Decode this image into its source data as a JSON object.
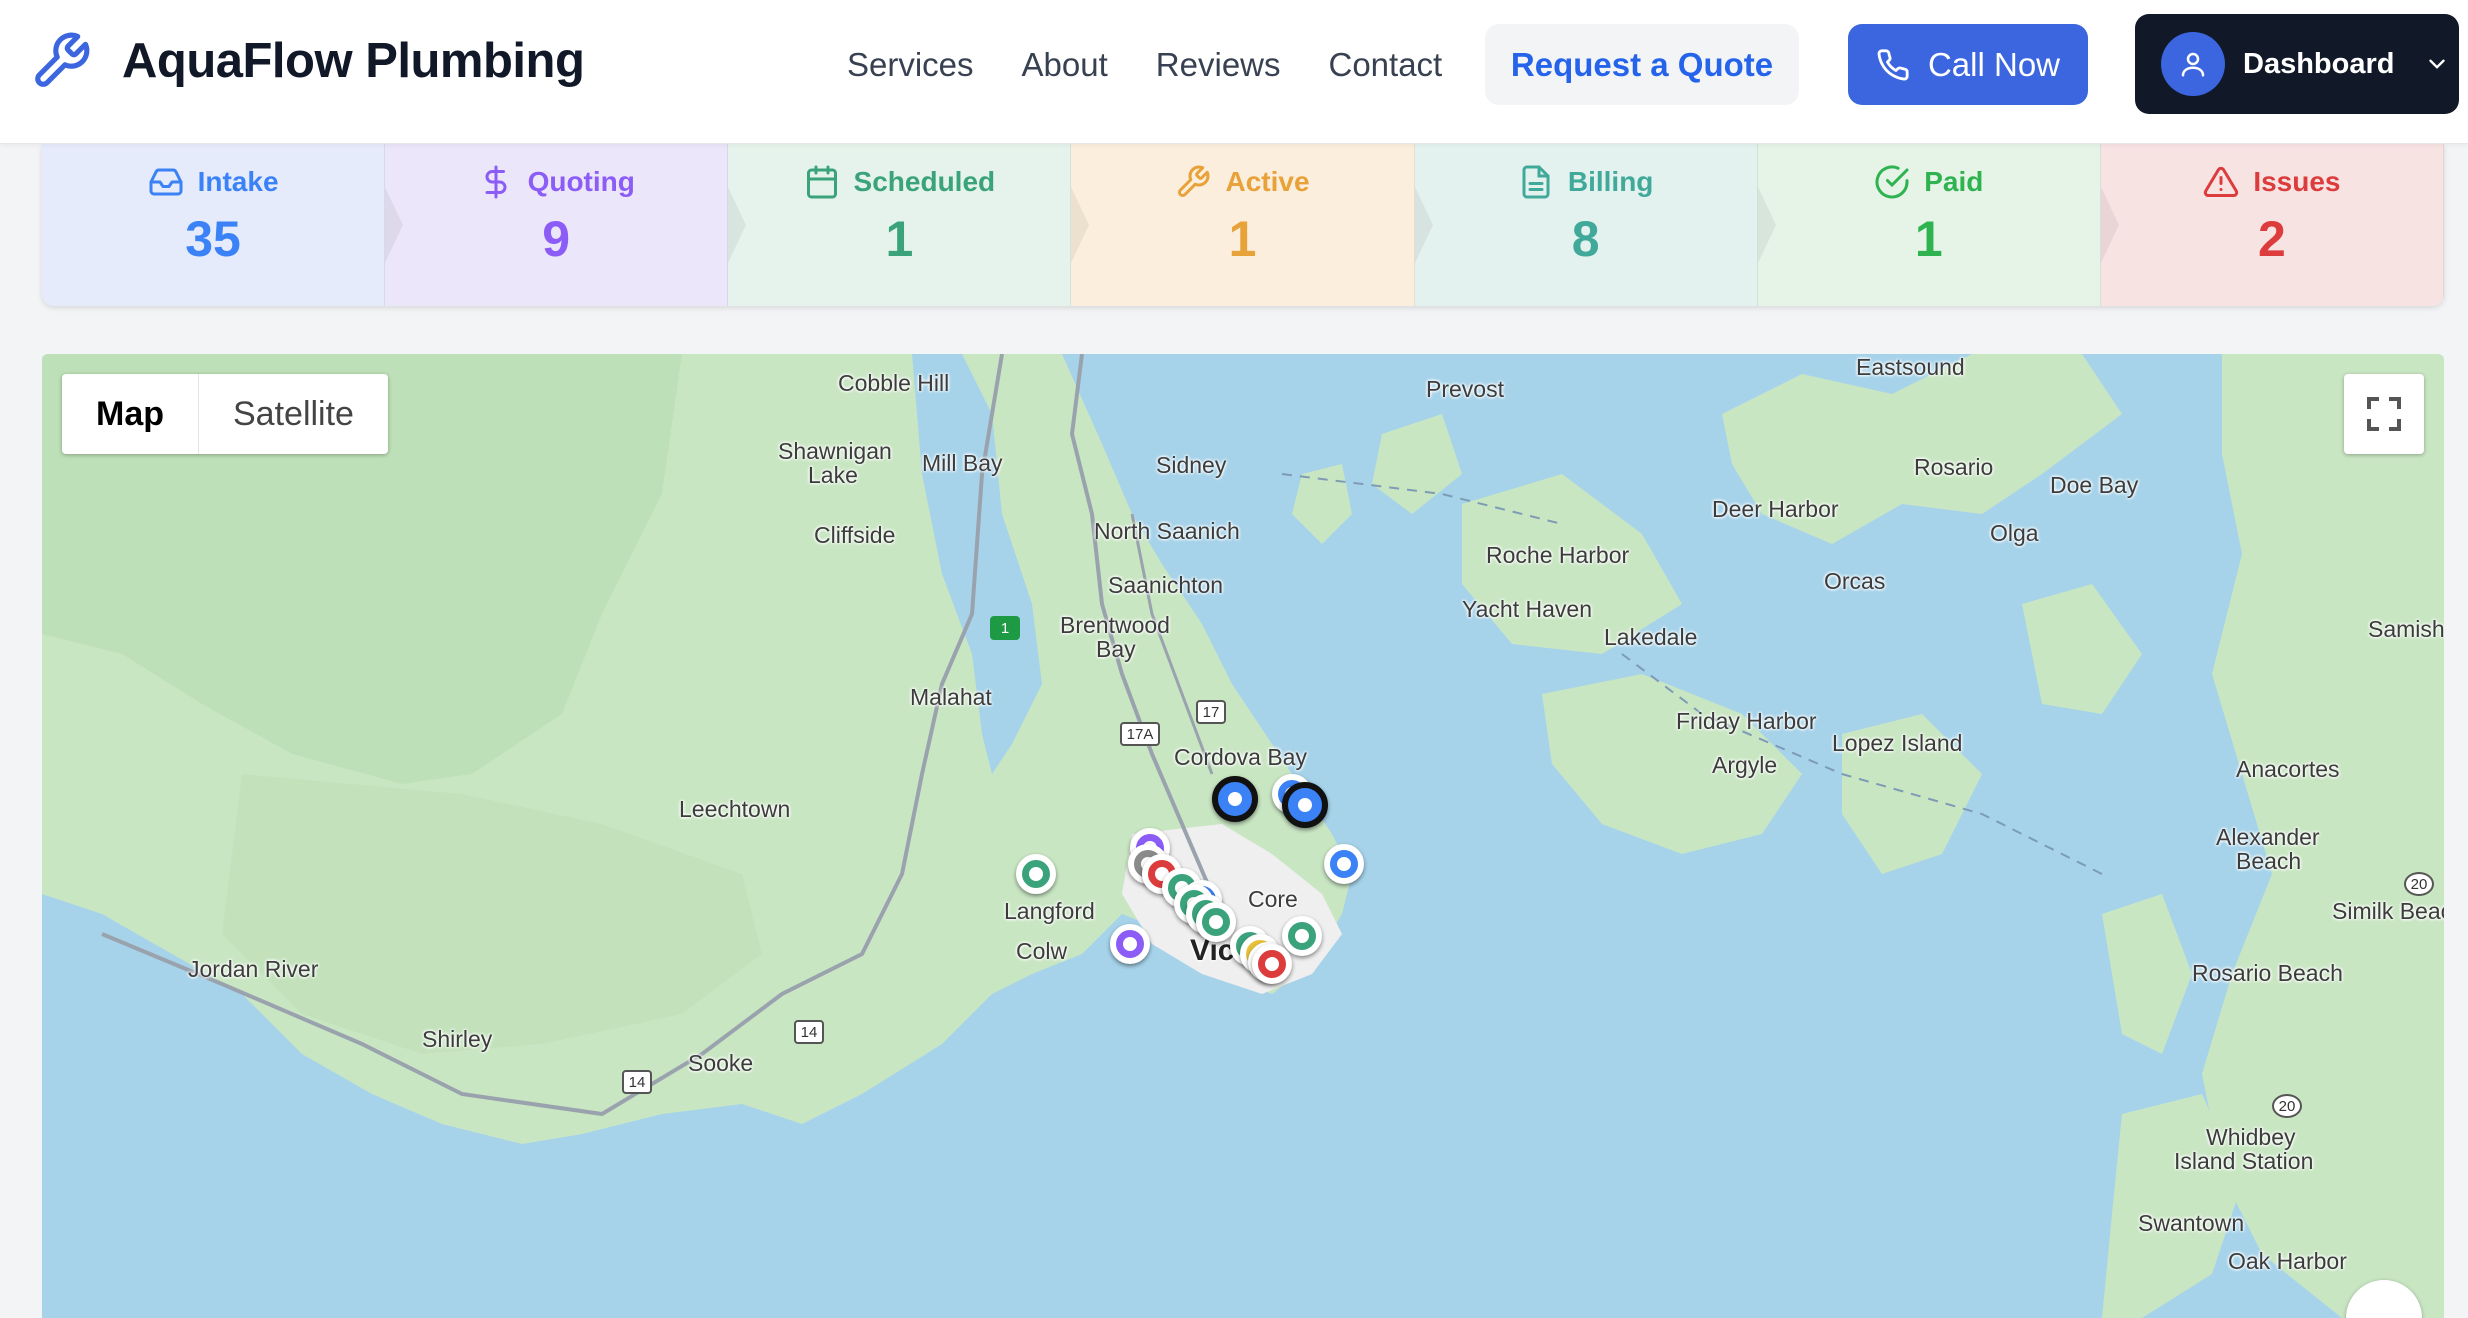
{
  "header": {
    "brand": "AquaFlow Plumbing",
    "nav": [
      "Services",
      "About",
      "Reviews",
      "Contact"
    ],
    "quote_button": "Request a Quote",
    "call_button": "Call Now",
    "dashboard_button": "Dashboard"
  },
  "pipeline": [
    {
      "label": "Intake",
      "count": "35",
      "color": "#3b82f6",
      "bg": "#e6ebfb",
      "icon": "inbox-icon"
    },
    {
      "label": "Quoting",
      "count": "9",
      "color": "#8b5cf6",
      "bg": "#ece6fa",
      "icon": "dollar-icon"
    },
    {
      "label": "Scheduled",
      "count": "1",
      "color": "#3ba37c",
      "bg": "#e6f3ec",
      "icon": "calendar-icon"
    },
    {
      "label": "Active",
      "count": "1",
      "color": "#e8a23a",
      "bg": "#fbeedc",
      "icon": "wrench-icon"
    },
    {
      "label": "Billing",
      "count": "8",
      "color": "#41a99a",
      "bg": "#e4f2ef",
      "icon": "file-icon"
    },
    {
      "label": "Paid",
      "count": "1",
      "color": "#2fb350",
      "bg": "#e6f4e8",
      "icon": "check-circle-icon"
    },
    {
      "label": "Issues",
      "count": "2",
      "color": "#dc3c3c",
      "bg": "#f8e3e3",
      "icon": "warning-icon"
    }
  ],
  "map": {
    "type_map": "Map",
    "type_satellite": "Satellite",
    "places": {
      "cobble_hill": "Cobble Hill",
      "shawnigan": "Shawnigan",
      "lake": "Lake",
      "mill_bay": "Mill Bay",
      "cliffside": "Cliffside",
      "sidney": "Sidney",
      "north_saanich": "North Saanich",
      "saanichton": "Saanichton",
      "brentwood": "Brentwood",
      "bay": "Bay",
      "malahat": "Malahat",
      "cordova_bay": "Cordova Bay",
      "leechtown": "Leechtown",
      "langford": "Langford",
      "colw": "Colw",
      "core": "Core",
      "vic": "Vic",
      "jordan_river": "Jordan River",
      "shirley": "Shirley",
      "sooke": "Sooke",
      "prevost": "Prevost",
      "eastsound": "Eastsound",
      "rosario": "Rosario",
      "doe_bay": "Doe Bay",
      "deer_harbor": "Deer Harbor",
      "olga": "Olga",
      "roche_harbor": "Roche Harbor",
      "orcas": "Orcas",
      "yacht_haven": "Yacht Haven",
      "lakedale": "Lakedale",
      "samish": "Samish",
      "friday_harbor": "Friday Harbor",
      "lopez_island": "Lopez Island",
      "argyle": "Argyle",
      "anacortes": "Anacortes",
      "alexander": "Alexander",
      "beach": "Beach",
      "similk_beach": "Similk Beac",
      "rosario_beach": "Rosario Beach",
      "whidbey": "Whidbey",
      "island_station": "Island Station",
      "swantown": "Swantown",
      "oak_harbor": "Oak Harbor"
    },
    "shields": {
      "r1": "1",
      "r17a": "17A",
      "r17": "17",
      "r14a": "14",
      "r14b": "14",
      "r20a": "20",
      "r20b": "20"
    },
    "marker_colors": {
      "intake": "#3b82f6",
      "quoting": "#8b5cf6",
      "paid": "#3ba37c",
      "issue": "#dc3c3c",
      "grey": "#8a8a8a"
    }
  }
}
